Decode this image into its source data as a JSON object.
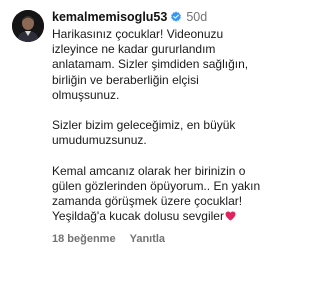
{
  "comment": {
    "username": "kemalmemisoglu53",
    "time": "50d",
    "text": "Harikasınız çocuklar! Videonuzu\nizleyince ne kadar gururlandım\nanlatamam. Sizler şimdiden sağlığın,\nbirliğin ve beraberliğin elçisi\nolmuşsunuz.\n\nSizler bizim geleceğimiz, en büyük\numudumuzsunuz.\n\nKemal amcanız olarak her birinizin o\ngülen gözlerinden öpüyorum.. En yakın\nzamanda görüşmek üzere çocuklar!\nYeşildağ'a kucak dolusu sevgiler",
    "emoji": "red-heart-emoji",
    "likes": "18 beğenme",
    "reply_label": "Yanıtla"
  },
  "colors": {
    "verified": "#3897f0",
    "heart": "#e0245e",
    "muted": "#737373"
  }
}
